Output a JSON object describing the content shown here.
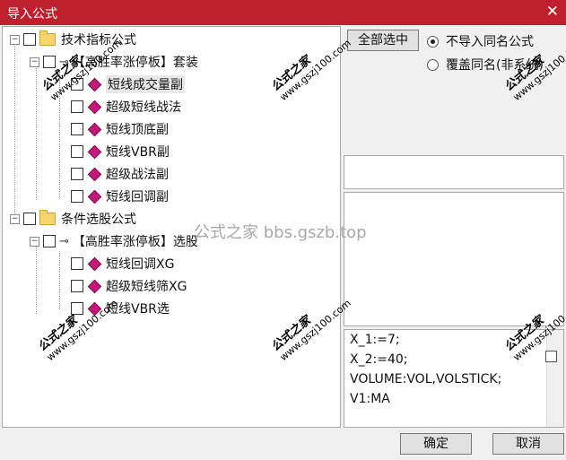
{
  "window": {
    "title": "导入公式",
    "close_glyph": "✕"
  },
  "tree": {
    "groups": [
      {
        "label": "技术指标公式",
        "sub": {
          "label": "【高胜率涨停板】套装",
          "items": [
            "短线成交量副",
            "超级短线战法",
            "短线顶底副",
            "短线VBR副",
            "超级战法副",
            "短线回调副"
          ]
        }
      },
      {
        "label": "条件选股公式",
        "sub": {
          "label": "【高胜率涨停板】选股",
          "items": [
            "短线回调XG",
            "超级短线筛XG",
            "短线VBR选"
          ]
        }
      }
    ]
  },
  "buttons": {
    "select_all": "全部选中",
    "ok": "确定",
    "cancel": "取消"
  },
  "radios": [
    {
      "label": "不导入同名公式",
      "checked": true
    },
    {
      "label": "覆盖同名(非系统)",
      "checked": false
    }
  ],
  "code_lines": [
    "X_1:=7;",
    "X_2:=40;",
    "VOLUME:VOL,VOLSTICK;",
    "V1:MA"
  ],
  "watermark": {
    "brand": "公式之家",
    "url": "www.gszj100.com",
    "center": "公式之家 bbs.gszb.top"
  }
}
